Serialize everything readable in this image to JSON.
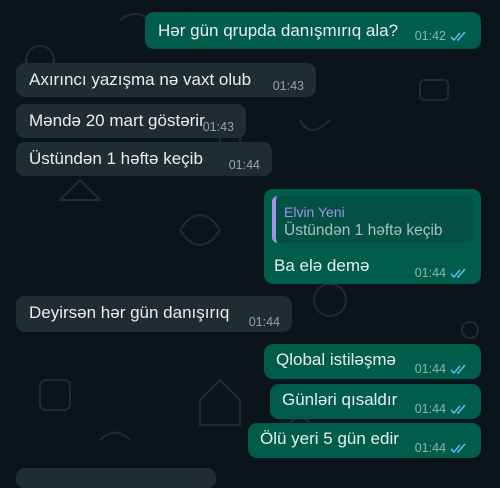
{
  "chat": {
    "messages": [
      {
        "direction": "out",
        "text": "Hər gün qrupda danışmırıq ala?",
        "time": "01:42",
        "status": "read"
      },
      {
        "direction": "in",
        "text": "Axırıncı yazışma nə vaxt olub",
        "time": "01:43"
      },
      {
        "direction": "in",
        "text": "Məndə 20 mart göstərir",
        "time": "01:43"
      },
      {
        "direction": "in",
        "text": "Üstündən 1 həftə keçib",
        "time": "01:44"
      },
      {
        "direction": "out",
        "text": "Ba elə demə",
        "time": "01:44",
        "status": "read",
        "reply_to": {
          "author": "Elvin Yeni",
          "text": "Üstündən 1 həftə keçib"
        }
      },
      {
        "direction": "in",
        "text": "Deyirsən hər gün danışırıq",
        "time": "01:44"
      },
      {
        "direction": "out",
        "text": "Qlobal istiləşmə",
        "time": "01:44",
        "status": "read"
      },
      {
        "direction": "out",
        "text": "Günləri qısaldır",
        "time": "01:44",
        "status": "read"
      },
      {
        "direction": "out",
        "text": "Ölü yeri 5 gün edir",
        "time": "01:44",
        "status": "read"
      }
    ]
  },
  "colors": {
    "background": "#0b141a",
    "outgoing_bubble": "#005c4b",
    "incoming_bubble": "#202c33",
    "read_check": "#53bdeb",
    "reply_accent": "#a691e9"
  },
  "icons": {
    "read_receipt": "double-check-icon"
  }
}
